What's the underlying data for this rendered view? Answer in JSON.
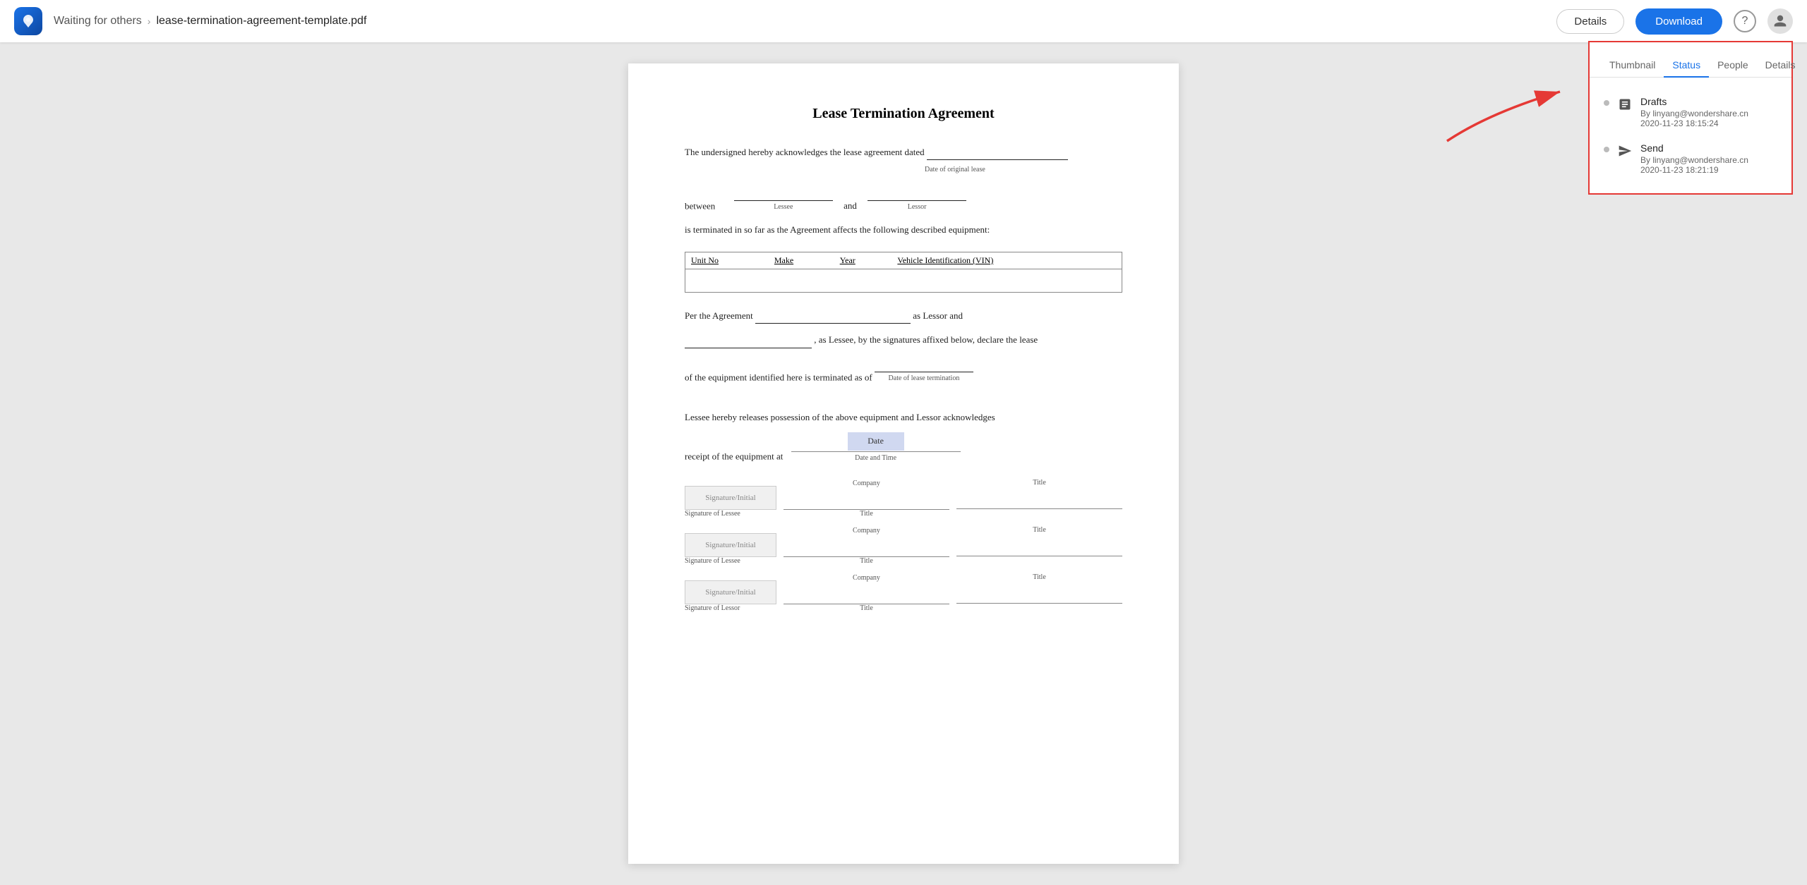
{
  "header": {
    "breadcrumb_waiting": "Waiting for others",
    "breadcrumb_filename": "lease-termination-agreement-template.pdf",
    "btn_details": "Details",
    "btn_download": "Download"
  },
  "panel": {
    "tabs": [
      "Thumbnail",
      "Status",
      "People",
      "Details"
    ],
    "active_tab": "Status",
    "status_items": [
      {
        "dot": true,
        "icon": "draft-icon",
        "name": "Drafts",
        "by": "By linyang@wondershare.cn",
        "time": "2020-11-23 18:15:24"
      },
      {
        "dot": true,
        "icon": "send-icon",
        "name": "Send",
        "by": "By linyang@wondershare.cn",
        "time": "2020-11-23 18:21:19"
      }
    ]
  },
  "pdf": {
    "title": "Lease Termination Agreement",
    "p1": "The undersigned hereby acknowledges the lease agreement dated",
    "p1_label": "Date of original lease",
    "p2_prefix": "between",
    "p2_lessee_label": "Lessee",
    "p2_and": "and",
    "p2_lessor_label": "Lessor",
    "p3": "is terminated in so far as the Agreement affects the following described equipment:",
    "table_headers": [
      "Unit No",
      "Make",
      "Year",
      "Vehicle Identification (VIN)"
    ],
    "p4": "Per the Agreement",
    "p4_mid": "as Lessor and",
    "p5": ", as Lessee, by the signatures affixed below, declare the lease",
    "p6": "of the equipment identified here is terminated as of",
    "p6_label": "Date of lease termination",
    "p7": "Lessee hereby releases possession of the above equipment and Lessor acknowledges",
    "p8_prefix": "receipt of the equipment at",
    "date_field": "Date",
    "date_time_label": "Date and Time",
    "sig_rows": [
      {
        "sig_label": "Signature/Initial",
        "sig_of": "Signature of Lessee",
        "company_label": "Company",
        "title_label": "Title"
      },
      {
        "sig_label": "Signature/Initial",
        "sig_of": "Signature of Lessee",
        "company_label": "Company",
        "title_label": "Title"
      },
      {
        "sig_label": "Signature/Initial",
        "sig_of": "Signature of Lessor",
        "company_label": "Company",
        "title_label": "Title"
      }
    ]
  }
}
